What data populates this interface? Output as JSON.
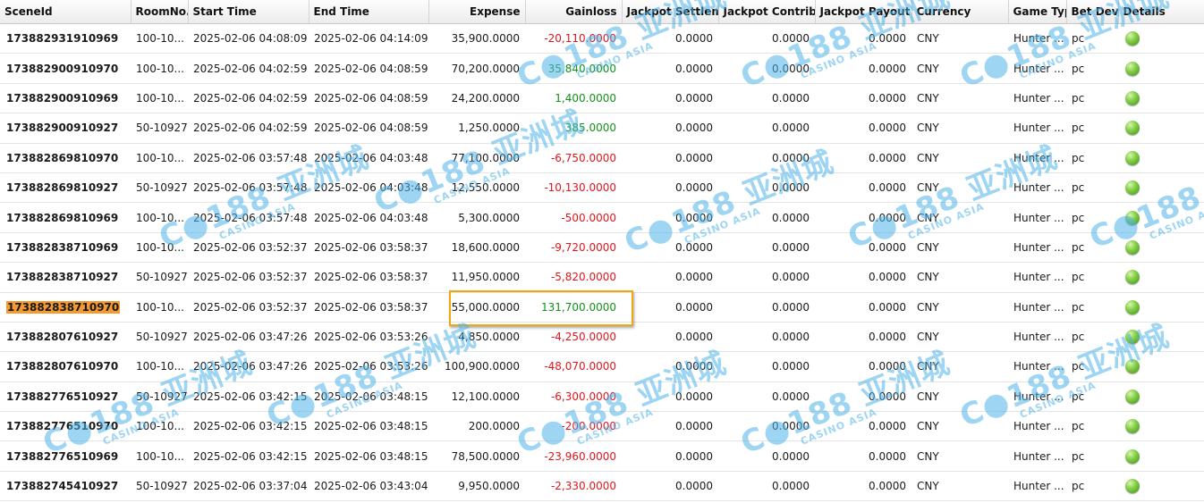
{
  "headers": {
    "scene_id": "SceneId",
    "room_no": "RoomNo...",
    "start_time": "Start Time",
    "end_time": "End Time",
    "expense": "Expense",
    "gainloss": "Gainloss",
    "jackpot_settlement": "Jackpot Settleme",
    "jackpot_contribution": "Jackpot Contribu",
    "jackpot_payout": "Jackpot Payout",
    "currency": "Currency",
    "game_type": "Game Typ",
    "bet_device": "Bet Devic",
    "details": "Details"
  },
  "rows": [
    {
      "scene_id": "173882931910969",
      "room": "100-10...",
      "start": "2025-02-06 04:08:09",
      "end": "2025-02-06 04:14:09",
      "expense": "35,900.0000",
      "gainloss": "-20,110.0000",
      "sign": "neg",
      "settle": "0.0000",
      "contrib": "0.0000",
      "payout": "0.0000",
      "currency": "CNY",
      "game": "Hunter ...",
      "device": "pc"
    },
    {
      "scene_id": "173882900910970",
      "room": "100-10...",
      "start": "2025-02-06 04:02:59",
      "end": "2025-02-06 04:08:59",
      "expense": "70,200.0000",
      "gainloss": "35,840.0000",
      "sign": "pos",
      "settle": "0.0000",
      "contrib": "0.0000",
      "payout": "0.0000",
      "currency": "CNY",
      "game": "Hunter ...",
      "device": "pc"
    },
    {
      "scene_id": "173882900910969",
      "room": "100-10...",
      "start": "2025-02-06 04:02:59",
      "end": "2025-02-06 04:08:59",
      "expense": "24,200.0000",
      "gainloss": "1,400.0000",
      "sign": "pos",
      "settle": "0.0000",
      "contrib": "0.0000",
      "payout": "0.0000",
      "currency": "CNY",
      "game": "Hunter ...",
      "device": "pc"
    },
    {
      "scene_id": "173882900910927",
      "room": "50-10927",
      "start": "2025-02-06 04:02:59",
      "end": "2025-02-06 04:08:59",
      "expense": "1,250.0000",
      "gainloss": "385.0000",
      "sign": "pos",
      "settle": "0.0000",
      "contrib": "0.0000",
      "payout": "0.0000",
      "currency": "CNY",
      "game": "Hunter ...",
      "device": "pc"
    },
    {
      "scene_id": "173882869810970",
      "room": "100-10...",
      "start": "2025-02-06 03:57:48",
      "end": "2025-02-06 04:03:48",
      "expense": "77,100.0000",
      "gainloss": "-6,750.0000",
      "sign": "neg",
      "settle": "0.0000",
      "contrib": "0.0000",
      "payout": "0.0000",
      "currency": "CNY",
      "game": "Hunter ...",
      "device": "pc"
    },
    {
      "scene_id": "173882869810927",
      "room": "50-10927",
      "start": "2025-02-06 03:57:48",
      "end": "2025-02-06 04:03:48",
      "expense": "12,550.0000",
      "gainloss": "-10,130.0000",
      "sign": "neg",
      "settle": "0.0000",
      "contrib": "0.0000",
      "payout": "0.0000",
      "currency": "CNY",
      "game": "Hunter ...",
      "device": "pc"
    },
    {
      "scene_id": "173882869810969",
      "room": "100-10...",
      "start": "2025-02-06 03:57:48",
      "end": "2025-02-06 04:03:48",
      "expense": "5,300.0000",
      "gainloss": "-500.0000",
      "sign": "neg",
      "settle": "0.0000",
      "contrib": "0.0000",
      "payout": "0.0000",
      "currency": "CNY",
      "game": "Hunter ...",
      "device": "pc"
    },
    {
      "scene_id": "173882838710969",
      "room": "100-10...",
      "start": "2025-02-06 03:52:37",
      "end": "2025-02-06 03:58:37",
      "expense": "18,600.0000",
      "gainloss": "-9,720.0000",
      "sign": "neg",
      "settle": "0.0000",
      "contrib": "0.0000",
      "payout": "0.0000",
      "currency": "CNY",
      "game": "Hunter ...",
      "device": "pc"
    },
    {
      "scene_id": "173882838710927",
      "room": "50-10927",
      "start": "2025-02-06 03:52:37",
      "end": "2025-02-06 03:58:37",
      "expense": "11,950.0000",
      "gainloss": "-5,820.0000",
      "sign": "neg",
      "settle": "0.0000",
      "contrib": "0.0000",
      "payout": "0.0000",
      "currency": "CNY",
      "game": "Hunter ...",
      "device": "pc"
    },
    {
      "scene_id": "173882838710970",
      "room": "100-10...",
      "start": "2025-02-06 03:52:37",
      "end": "2025-02-06 03:58:37",
      "expense": "55,000.0000",
      "gainloss": "131,700.0000",
      "sign": "pos",
      "settle": "0.0000",
      "contrib": "0.0000",
      "payout": "0.0000",
      "currency": "CNY",
      "game": "Hunter ...",
      "device": "pc",
      "highlight": true
    },
    {
      "scene_id": "173882807610927",
      "room": "50-10927",
      "start": "2025-02-06 03:47:26",
      "end": "2025-02-06 03:53:26",
      "expense": "4,850.0000",
      "gainloss": "-4,250.0000",
      "sign": "neg",
      "settle": "0.0000",
      "contrib": "0.0000",
      "payout": "0.0000",
      "currency": "CNY",
      "game": "Hunter ...",
      "device": "pc"
    },
    {
      "scene_id": "173882807610970",
      "room": "100-10...",
      "start": "2025-02-06 03:47:26",
      "end": "2025-02-06 03:53:26",
      "expense": "100,900.0000",
      "gainloss": "-48,070.0000",
      "sign": "neg",
      "settle": "0.0000",
      "contrib": "0.0000",
      "payout": "0.0000",
      "currency": "CNY",
      "game": "Hunter ...",
      "device": "pc"
    },
    {
      "scene_id": "173882776510927",
      "room": "50-10927",
      "start": "2025-02-06 03:42:15",
      "end": "2025-02-06 03:48:15",
      "expense": "12,100.0000",
      "gainloss": "-6,300.0000",
      "sign": "neg",
      "settle": "0.0000",
      "contrib": "0.0000",
      "payout": "0.0000",
      "currency": "CNY",
      "game": "Hunter ...",
      "device": "pc"
    },
    {
      "scene_id": "173882776510970",
      "room": "100-10...",
      "start": "2025-02-06 03:42:15",
      "end": "2025-02-06 03:48:15",
      "expense": "200.0000",
      "gainloss": "-200.0000",
      "sign": "neg",
      "settle": "0.0000",
      "contrib": "0.0000",
      "payout": "0.0000",
      "currency": "CNY",
      "game": "Hunter ...",
      "device": "pc"
    },
    {
      "scene_id": "173882776510969",
      "room": "100-10...",
      "start": "2025-02-06 03:42:15",
      "end": "2025-02-06 03:48:15",
      "expense": "78,500.0000",
      "gainloss": "-23,960.0000",
      "sign": "neg",
      "settle": "0.0000",
      "contrib": "0.0000",
      "payout": "0.0000",
      "currency": "CNY",
      "game": "Hunter ...",
      "device": "pc"
    },
    {
      "scene_id": "173882745410927",
      "room": "50-10927",
      "start": "2025-02-06 03:37:04",
      "end": "2025-02-06 03:43:04",
      "expense": "9,950.0000",
      "gainloss": "-2,330.0000",
      "sign": "neg",
      "settle": "0.0000",
      "contrib": "0.0000",
      "payout": "0.0000",
      "currency": "CNY",
      "game": "Hunter ...",
      "device": "pc"
    }
  ],
  "colors": {
    "negative": "#e0161d",
    "positive": "#139219",
    "highlight": "#f39a32",
    "callout_border": "#f0a811",
    "watermark": "#4fb3e8"
  },
  "watermark": {
    "brand": "C●188 亚洲城",
    "tagline": "CASINO ASIA"
  },
  "icons": {
    "details": "green-orb-icon"
  }
}
